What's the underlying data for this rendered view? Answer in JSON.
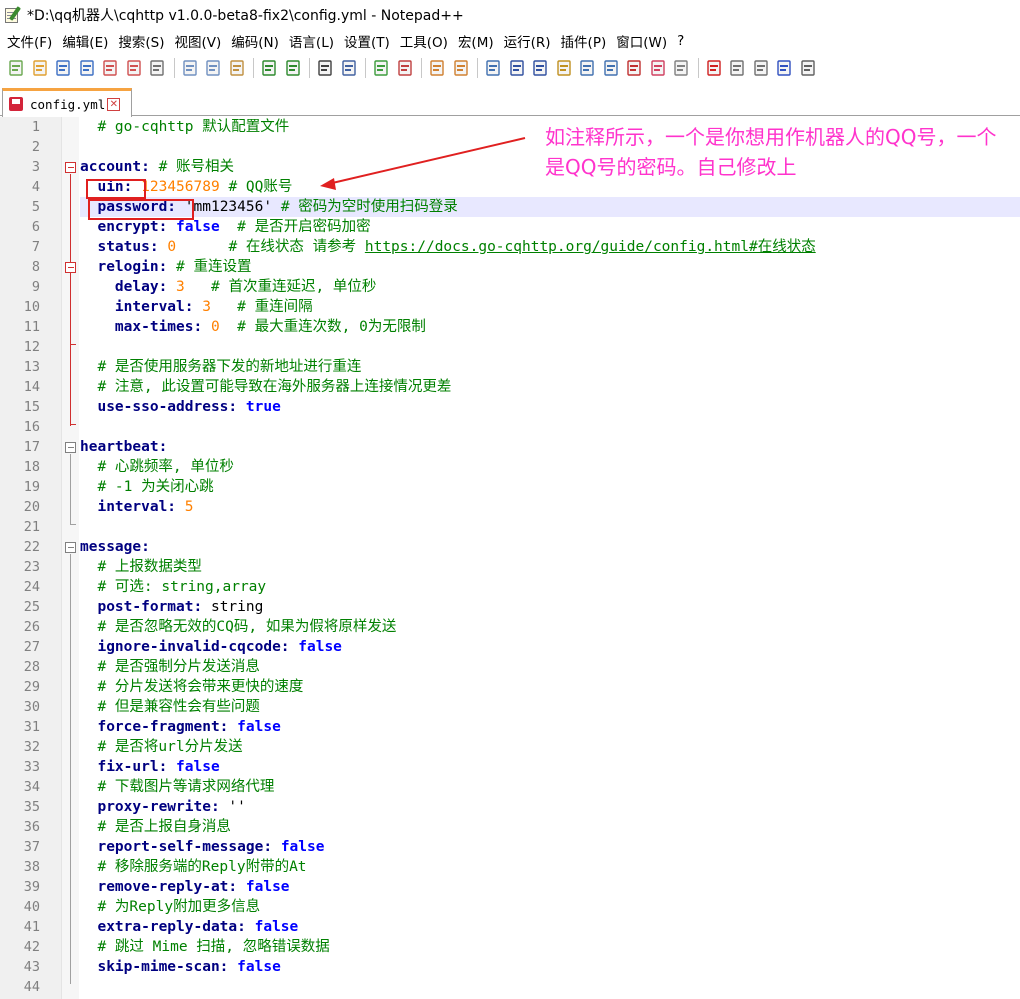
{
  "window": {
    "title": "*D:\\qq机器人\\cqhttp v1.0.0-beta8-fix2\\config.yml - Notepad++"
  },
  "menu": {
    "items": [
      "文件(F)",
      "编辑(E)",
      "搜索(S)",
      "视图(V)",
      "编码(N)",
      "语言(L)",
      "设置(T)",
      "工具(O)",
      "宏(M)",
      "运行(R)",
      "插件(P)",
      "窗口(W)",
      "?"
    ]
  },
  "toolbar": {
    "icons": [
      "new-file-icon",
      "open-file-icon",
      "save-icon",
      "save-all-icon",
      "close-icon",
      "close-all-icon",
      "print-icon",
      "cut-icon",
      "copy-icon",
      "paste-icon",
      "undo-icon",
      "redo-icon",
      "find-icon",
      "replace-icon",
      "zoom-in-icon",
      "zoom-out-icon",
      "sync-vertical-icon",
      "sync-horizontal-icon",
      "word-wrap-icon",
      "show-all-chars-icon",
      "indent-guide-icon",
      "lang-icon",
      "udl-icon",
      "doc-map-icon",
      "function-list-icon",
      "folder-workspace-icon",
      "monitor-icon",
      "record-macro-icon",
      "stop-macro-icon",
      "play-macro-icon",
      "run-macro-multiple-icon",
      "save-macro-icon"
    ]
  },
  "tab": {
    "label": "config.yml",
    "close": "✕"
  },
  "annotation": {
    "text": "如注释所示，一个是你想用作机器人的QQ号，一个是QQ号的密码。自己修改上"
  },
  "editor": {
    "lines": [
      {
        "n": "1",
        "parts": [
          [
            "c",
            "  # go-cqhttp 默认配置文件"
          ]
        ]
      },
      {
        "n": "2",
        "parts": []
      },
      {
        "n": "3",
        "parts": [
          [
            "k",
            "account:"
          ],
          [
            "s",
            " "
          ],
          [
            "c",
            "# 账号相关"
          ]
        ]
      },
      {
        "n": "4",
        "parts": [
          [
            "s",
            "  "
          ],
          [
            "k",
            "uin:"
          ],
          [
            "s",
            " "
          ],
          [
            "n",
            "123456789"
          ],
          [
            "s",
            " "
          ],
          [
            "c",
            "# QQ账号"
          ]
        ]
      },
      {
        "n": "5",
        "parts": [
          [
            "s",
            "  "
          ],
          [
            "k",
            "password:"
          ],
          [
            "s",
            " 'mm123456' "
          ],
          [
            "c",
            "# 密码为空时使用扫码登录"
          ]
        ]
      },
      {
        "n": "6",
        "parts": [
          [
            "s",
            "  "
          ],
          [
            "k",
            "encrypt:"
          ],
          [
            "s",
            " "
          ],
          [
            "b",
            "false"
          ],
          [
            "s",
            "  "
          ],
          [
            "c",
            "# 是否开启密码加密"
          ]
        ]
      },
      {
        "n": "7",
        "parts": [
          [
            "s",
            "  "
          ],
          [
            "k",
            "status:"
          ],
          [
            "s",
            " "
          ],
          [
            "n",
            "0"
          ],
          [
            "s",
            "      "
          ],
          [
            "c",
            "# 在线状态 请参考 "
          ],
          [
            "u",
            "https://docs.go-cqhttp.org/guide/config.html#在线状态"
          ]
        ]
      },
      {
        "n": "8",
        "parts": [
          [
            "s",
            "  "
          ],
          [
            "k",
            "relogin:"
          ],
          [
            "s",
            " "
          ],
          [
            "c",
            "# 重连设置"
          ]
        ]
      },
      {
        "n": "9",
        "parts": [
          [
            "s",
            "    "
          ],
          [
            "k",
            "delay:"
          ],
          [
            "s",
            " "
          ],
          [
            "n",
            "3"
          ],
          [
            "s",
            "   "
          ],
          [
            "c",
            "# 首次重连延迟, 单位秒"
          ]
        ]
      },
      {
        "n": "10",
        "parts": [
          [
            "s",
            "    "
          ],
          [
            "k",
            "interval:"
          ],
          [
            "s",
            " "
          ],
          [
            "n",
            "3"
          ],
          [
            "s",
            "   "
          ],
          [
            "c",
            "# 重连间隔"
          ]
        ]
      },
      {
        "n": "11",
        "parts": [
          [
            "s",
            "    "
          ],
          [
            "k",
            "max-times:"
          ],
          [
            "s",
            " "
          ],
          [
            "n",
            "0"
          ],
          [
            "s",
            "  "
          ],
          [
            "c",
            "# 最大重连次数, 0为无限制"
          ]
        ]
      },
      {
        "n": "12",
        "parts": []
      },
      {
        "n": "13",
        "parts": [
          [
            "s",
            "  "
          ],
          [
            "c",
            "# 是否使用服务器下发的新地址进行重连"
          ]
        ]
      },
      {
        "n": "14",
        "parts": [
          [
            "s",
            "  "
          ],
          [
            "c",
            "# 注意, 此设置可能导致在海外服务器上连接情况更差"
          ]
        ]
      },
      {
        "n": "15",
        "parts": [
          [
            "s",
            "  "
          ],
          [
            "k",
            "use-sso-address:"
          ],
          [
            "s",
            " "
          ],
          [
            "b",
            "true"
          ]
        ]
      },
      {
        "n": "16",
        "parts": []
      },
      {
        "n": "17",
        "parts": [
          [
            "k",
            "heartbeat:"
          ]
        ]
      },
      {
        "n": "18",
        "parts": [
          [
            "s",
            "  "
          ],
          [
            "c",
            "# 心跳频率, 单位秒"
          ]
        ]
      },
      {
        "n": "19",
        "parts": [
          [
            "s",
            "  "
          ],
          [
            "c",
            "# -1 为关闭心跳"
          ]
        ]
      },
      {
        "n": "20",
        "parts": [
          [
            "s",
            "  "
          ],
          [
            "k",
            "interval:"
          ],
          [
            "s",
            " "
          ],
          [
            "n",
            "5"
          ]
        ]
      },
      {
        "n": "21",
        "parts": []
      },
      {
        "n": "22",
        "parts": [
          [
            "k",
            "message:"
          ]
        ]
      },
      {
        "n": "23",
        "parts": [
          [
            "s",
            "  "
          ],
          [
            "c",
            "# 上报数据类型"
          ]
        ]
      },
      {
        "n": "24",
        "parts": [
          [
            "s",
            "  "
          ],
          [
            "c",
            "# 可选: string,array"
          ]
        ]
      },
      {
        "n": "25",
        "parts": [
          [
            "s",
            "  "
          ],
          [
            "k",
            "post-format:"
          ],
          [
            "s",
            " string"
          ]
        ]
      },
      {
        "n": "26",
        "parts": [
          [
            "s",
            "  "
          ],
          [
            "c",
            "# 是否忽略无效的CQ码, 如果为假将原样发送"
          ]
        ]
      },
      {
        "n": "27",
        "parts": [
          [
            "s",
            "  "
          ],
          [
            "k",
            "ignore-invalid-cqcode:"
          ],
          [
            "s",
            " "
          ],
          [
            "b",
            "false"
          ]
        ]
      },
      {
        "n": "28",
        "parts": [
          [
            "s",
            "  "
          ],
          [
            "c",
            "# 是否强制分片发送消息"
          ]
        ]
      },
      {
        "n": "29",
        "parts": [
          [
            "s",
            "  "
          ],
          [
            "c",
            "# 分片发送将会带来更快的速度"
          ]
        ]
      },
      {
        "n": "30",
        "parts": [
          [
            "s",
            "  "
          ],
          [
            "c",
            "# 但是兼容性会有些问题"
          ]
        ]
      },
      {
        "n": "31",
        "parts": [
          [
            "s",
            "  "
          ],
          [
            "k",
            "force-fragment:"
          ],
          [
            "s",
            " "
          ],
          [
            "b",
            "false"
          ]
        ]
      },
      {
        "n": "32",
        "parts": [
          [
            "s",
            "  "
          ],
          [
            "c",
            "# 是否将url分片发送"
          ]
        ]
      },
      {
        "n": "33",
        "parts": [
          [
            "s",
            "  "
          ],
          [
            "k",
            "fix-url:"
          ],
          [
            "s",
            " "
          ],
          [
            "b",
            "false"
          ]
        ]
      },
      {
        "n": "34",
        "parts": [
          [
            "s",
            "  "
          ],
          [
            "c",
            "# 下载图片等请求网络代理"
          ]
        ]
      },
      {
        "n": "35",
        "parts": [
          [
            "s",
            "  "
          ],
          [
            "k",
            "proxy-rewrite:"
          ],
          [
            "s",
            " ''"
          ]
        ]
      },
      {
        "n": "36",
        "parts": [
          [
            "s",
            "  "
          ],
          [
            "c",
            "# 是否上报自身消息"
          ]
        ]
      },
      {
        "n": "37",
        "parts": [
          [
            "s",
            "  "
          ],
          [
            "k",
            "report-self-message:"
          ],
          [
            "s",
            " "
          ],
          [
            "b",
            "false"
          ]
        ]
      },
      {
        "n": "38",
        "parts": [
          [
            "s",
            "  "
          ],
          [
            "c",
            "# 移除服务端的Reply附带的At"
          ]
        ]
      },
      {
        "n": "39",
        "parts": [
          [
            "s",
            "  "
          ],
          [
            "k",
            "remove-reply-at:"
          ],
          [
            "s",
            " "
          ],
          [
            "b",
            "false"
          ]
        ]
      },
      {
        "n": "40",
        "parts": [
          [
            "s",
            "  "
          ],
          [
            "c",
            "# 为Reply附加更多信息"
          ]
        ]
      },
      {
        "n": "41",
        "parts": [
          [
            "s",
            "  "
          ],
          [
            "k",
            "extra-reply-data:"
          ],
          [
            "s",
            " "
          ],
          [
            "b",
            "false"
          ]
        ]
      },
      {
        "n": "42",
        "parts": [
          [
            "s",
            "  "
          ],
          [
            "c",
            "# 跳过 Mime 扫描, 忽略错误数据"
          ]
        ]
      },
      {
        "n": "43",
        "parts": [
          [
            "s",
            "  "
          ],
          [
            "k",
            "skip-mime-scan:"
          ],
          [
            "s",
            " "
          ],
          [
            "b",
            "false"
          ]
        ]
      },
      {
        "n": "44",
        "parts": []
      }
    ]
  },
  "colors": {
    "keyword": "#000080",
    "comment": "#008000",
    "number": "#ff8000",
    "boolean": "#0000ff",
    "annotation": "#ff33cc",
    "highlight_box": "#e02020",
    "current_line": "#e8e8ff"
  }
}
